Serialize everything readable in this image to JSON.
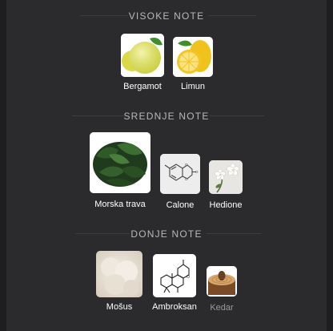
{
  "sections": [
    {
      "title": "VISOKE NOTE",
      "notes": [
        {
          "label": "Bergamot",
          "icon": "bergamot-image"
        },
        {
          "label": "Limun",
          "icon": "lemon-image"
        }
      ]
    },
    {
      "title": "SREDNJE NOTE",
      "notes": [
        {
          "label": "Morska trava",
          "icon": "seaweed-image"
        },
        {
          "label": "Calone",
          "icon": "calone-molecule-image"
        },
        {
          "label": "Hedione",
          "icon": "jasmine-flower-image"
        }
      ]
    },
    {
      "title": "DONJE NOTE",
      "notes": [
        {
          "label": "Mošus",
          "icon": "musk-cotton-image"
        },
        {
          "label": "Ambroksan",
          "icon": "ambroxan-molecule-image"
        },
        {
          "label": "Kedar",
          "icon": "cedar-wood-image"
        }
      ]
    }
  ],
  "colors": {
    "background": "#2b2b2d",
    "title": "#b9b9bc",
    "label": "#ffffff",
    "label_dim": "#9a9a9d"
  }
}
